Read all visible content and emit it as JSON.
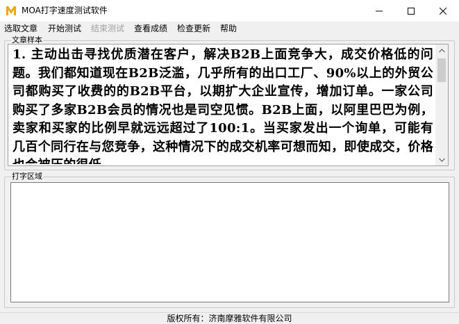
{
  "window": {
    "title": "MOA打字速度测试软件",
    "logo_letter": "M",
    "accent_color": "#f7a21b"
  },
  "menu": {
    "items": [
      {
        "label": "选取文章",
        "enabled": true
      },
      {
        "label": "开始测试",
        "enabled": true
      },
      {
        "label": "结束测试",
        "enabled": false
      },
      {
        "label": "查看成绩",
        "enabled": true
      },
      {
        "label": "检查更新",
        "enabled": true
      },
      {
        "label": "帮助",
        "enabled": true
      }
    ]
  },
  "sample": {
    "group_label": "文章样本",
    "text": "1. 主动出击寻找优质潜在客户，解决B2B上面竞争大，成交价格低的问题。我们都知道现在B2B泛滥，几乎所有的出口工厂、90%以上的外贸公司都购买了收费的的B2B平台，以期扩大企业宣传，增加订单。一家公司购买了多家B2B会员的情况也是司空见惯。B2B上面，以阿里巴巴为例，卖家和买家的比例早就远远超过了100:1。当买家发出一个询单，可能有几百个同行在与您竞争，这种情况下的成交机率可想而知，即使成交，价格也会被压的很低。"
  },
  "typing": {
    "group_label": "打字区域",
    "value": ""
  },
  "status": {
    "copyright": "版权所有：济南摩雅软件有限公司"
  },
  "icons": {
    "logo": "moa-logo-icon",
    "minimize": "minimize-icon",
    "maximize": "maximize-icon",
    "close": "close-icon",
    "scroll_up": "scroll-up-arrow-icon",
    "scroll_down": "scroll-down-arrow-icon"
  }
}
